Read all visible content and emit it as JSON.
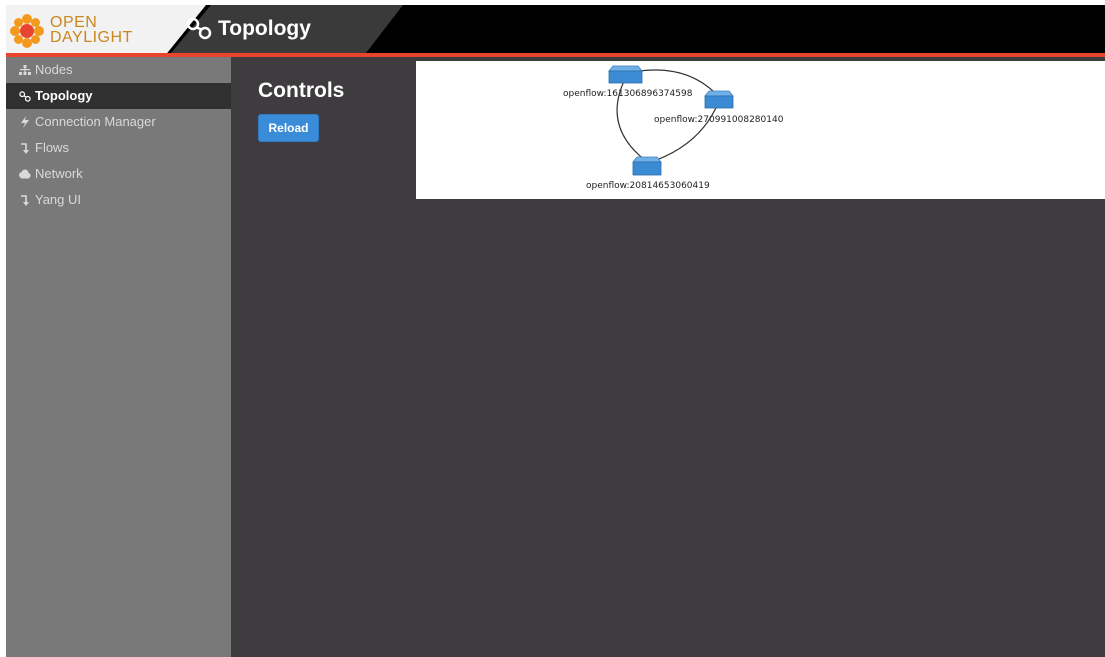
{
  "header": {
    "logo": {
      "line1": "OPEN",
      "line2": "DAYLIGHT"
    },
    "title": "Topology",
    "colors": {
      "accent_red": "#e8442e",
      "header_bg": "#000000"
    }
  },
  "sidebar": {
    "items": [
      {
        "label": "Nodes",
        "icon": "sitemap-icon",
        "active": false
      },
      {
        "label": "Topology",
        "icon": "topology-icon",
        "active": true
      },
      {
        "label": "Connection Manager",
        "icon": "bolt-icon",
        "active": false
      },
      {
        "label": "Flows",
        "icon": "flow-arrow-icon",
        "active": false
      },
      {
        "label": "Network",
        "icon": "cloud-icon",
        "active": false
      },
      {
        "label": "Yang UI",
        "icon": "flow-arrow-icon",
        "active": false
      }
    ]
  },
  "main": {
    "controls_title": "Controls",
    "reload_label": "Reload"
  },
  "topology": {
    "nodes": [
      {
        "label": "openflow:161306896374598"
      },
      {
        "label": "openflow:270991008280140"
      },
      {
        "label": "openflow:20814653060419"
      }
    ]
  }
}
